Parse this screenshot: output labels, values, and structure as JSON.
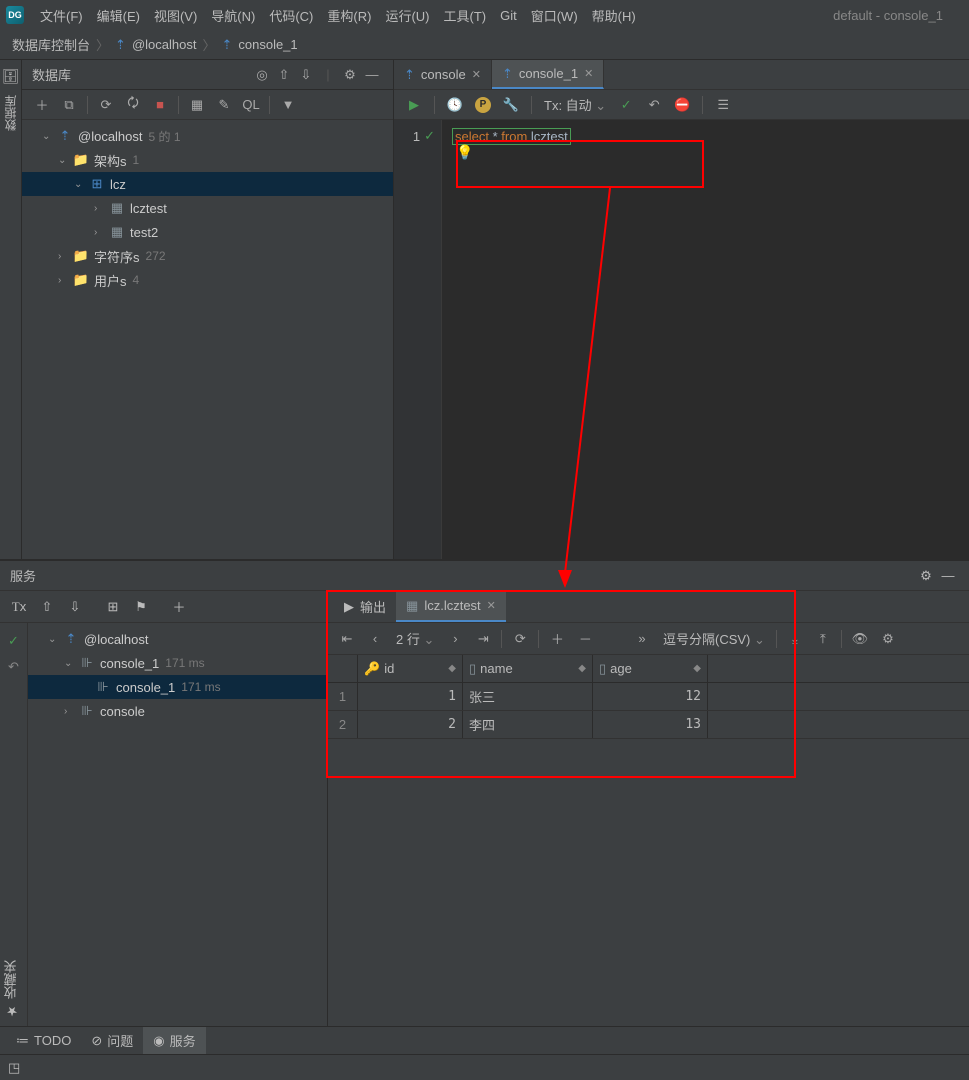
{
  "window_title": "default - console_1",
  "menu": {
    "file": "文件(F)",
    "edit": "编辑(E)",
    "view": "视图(V)",
    "navigate": "导航(N)",
    "code": "代码(C)",
    "refactor": "重构(R)",
    "run": "运行(U)",
    "tools": "工具(T)",
    "git": "Git",
    "window": "窗口(W)",
    "help": "帮助(H)"
  },
  "breadcrumb": {
    "root": "数据库控制台",
    "host": "@localhost",
    "console": "console_1"
  },
  "db_panel": {
    "title": "数据库",
    "tree": [
      {
        "label": "@localhost",
        "count": "5 的 1",
        "icon": "db",
        "lv": 1,
        "exp": true
      },
      {
        "label": "架构s",
        "count": "1",
        "icon": "folder",
        "lv": 2,
        "exp": true
      },
      {
        "label": "lcz",
        "icon": "schema",
        "lv": 3,
        "exp": true,
        "sel": true
      },
      {
        "label": "lcztest",
        "icon": "table",
        "lv": 4,
        "exp": false,
        "arrow": true
      },
      {
        "label": "test2",
        "icon": "table",
        "lv": 4,
        "exp": false,
        "arrow": true
      },
      {
        "label": "字符序s",
        "count": "272",
        "icon": "folder",
        "lv": 2,
        "exp": false,
        "arrow": true
      },
      {
        "label": "用户s",
        "count": "4",
        "icon": "folder",
        "lv": 2,
        "exp": false,
        "arrow": true
      }
    ]
  },
  "sidebar_tab": "数据库",
  "editor": {
    "tabs": [
      {
        "label": "console",
        "active": false
      },
      {
        "label": "console_1",
        "active": true
      }
    ],
    "tx_label": "Tx: 自动",
    "line_no": "1",
    "sql": {
      "kw1": "select",
      "star": "*",
      "kw2": "from",
      "tbl": "lcztest"
    }
  },
  "services": {
    "title": "服务",
    "left_tree": [
      {
        "label": "@localhost",
        "lv": 1,
        "exp": true,
        "icon": "db"
      },
      {
        "label": "console_1",
        "meta": "171 ms",
        "lv": 2,
        "exp": true,
        "icon": "con"
      },
      {
        "label": "console_1",
        "meta": "171 ms",
        "lv": 3,
        "sel": true,
        "icon": "con"
      },
      {
        "label": "console",
        "lv": 2,
        "arrow": true,
        "icon": "con"
      }
    ],
    "result_tabs": [
      {
        "label": "输出",
        "icon": "▶"
      },
      {
        "label": "lcz.lcztest",
        "icon": "table",
        "active": true
      }
    ],
    "pager": "2 行",
    "csv_label": "逗号分隔(CSV)",
    "columns": [
      {
        "name": "id",
        "key": true
      },
      {
        "name": "name"
      },
      {
        "name": "age"
      }
    ],
    "rows": [
      {
        "n": "1",
        "id": "1",
        "name": "张三",
        "age": "12"
      },
      {
        "n": "2",
        "id": "2",
        "name": "李四",
        "age": "13"
      }
    ]
  },
  "bottom": {
    "todo": "TODO",
    "problems": "问题",
    "services": "服务"
  },
  "fav": "收藏夹"
}
